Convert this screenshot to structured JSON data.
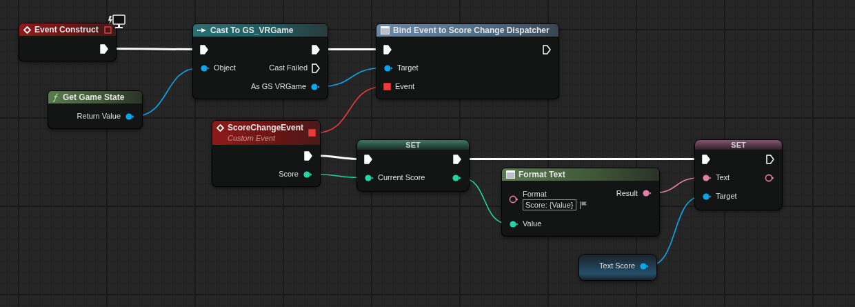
{
  "nodes": [
    {
      "kind": "event",
      "title": "Event Construct",
      "header_pin": {
        "kind": "delegate",
        "connected": false
      },
      "rows": [
        {
          "out": {
            "kind": "exec",
            "connected": true
          }
        }
      ]
    },
    {
      "kind": "cast",
      "title": "Cast To GS_VRGame",
      "rows": [
        {
          "in": {
            "kind": "exec",
            "connected": true
          },
          "out": {
            "kind": "exec",
            "connected": true
          }
        },
        {
          "in": {
            "kind": "object",
            "label": "Object",
            "connected": true
          },
          "out": {
            "kind": "exec",
            "label": "Cast Failed",
            "connected": false
          }
        },
        {
          "out": {
            "kind": "object",
            "label": "As GS VRGame",
            "connected": true
          }
        }
      ]
    },
    {
      "kind": "bind",
      "title": "Bind Event to Score Change Dispatcher",
      "rows": [
        {
          "in": {
            "kind": "exec",
            "connected": true
          },
          "out": {
            "kind": "exec",
            "connected": false
          }
        },
        {
          "in": {
            "kind": "object",
            "label": "Target",
            "connected": true
          }
        },
        {
          "in": {
            "kind": "delegate",
            "label": "Event",
            "connected": true
          }
        }
      ]
    },
    {
      "kind": "pure_function",
      "title": "Get Game State",
      "rows": [
        {
          "out": {
            "kind": "object",
            "label": "Return Value",
            "connected": true
          }
        }
      ]
    },
    {
      "kind": "custom_event",
      "title": "ScoreChangeEvent",
      "subtitle": "Custom Event",
      "header_pin": {
        "kind": "delegate",
        "connected": true
      },
      "rows": [
        {
          "out": {
            "kind": "exec",
            "connected": true
          }
        },
        {
          "out": {
            "kind": "int",
            "label": "Score",
            "connected": true
          }
        }
      ]
    },
    {
      "kind": "set",
      "title": "SET",
      "rows": [
        {
          "in": {
            "kind": "exec",
            "connected": true
          },
          "out": {
            "kind": "exec",
            "connected": true
          }
        },
        {
          "in": {
            "kind": "int",
            "label": "Current Score",
            "connected": true
          },
          "out": {
            "kind": "int",
            "connected": true
          }
        }
      ]
    },
    {
      "kind": "format",
      "title": "Format Text",
      "rows": [
        {
          "in": {
            "kind": "text",
            "label": "Format",
            "connected": false
          },
          "field": {
            "value": "Score: {Value}"
          },
          "out": {
            "kind": "text",
            "label": "Result",
            "connected": true
          }
        },
        {
          "in": {
            "kind": "int",
            "label": "Value",
            "connected": true
          }
        }
      ]
    },
    {
      "kind": "set",
      "title": "SET",
      "rows": [
        {
          "in": {
            "kind": "exec",
            "connected": true
          },
          "out": {
            "kind": "exec",
            "connected": false
          }
        },
        {
          "in": {
            "kind": "text",
            "label": "Text",
            "connected": true
          },
          "out": {
            "kind": "text",
            "connected": false
          }
        },
        {
          "in": {
            "kind": "object",
            "label": "Target",
            "connected": true
          }
        }
      ]
    },
    {
      "kind": "get",
      "rows": [
        {
          "out": {
            "kind": "object",
            "label": "Text Score",
            "connected": true
          }
        }
      ]
    }
  ]
}
